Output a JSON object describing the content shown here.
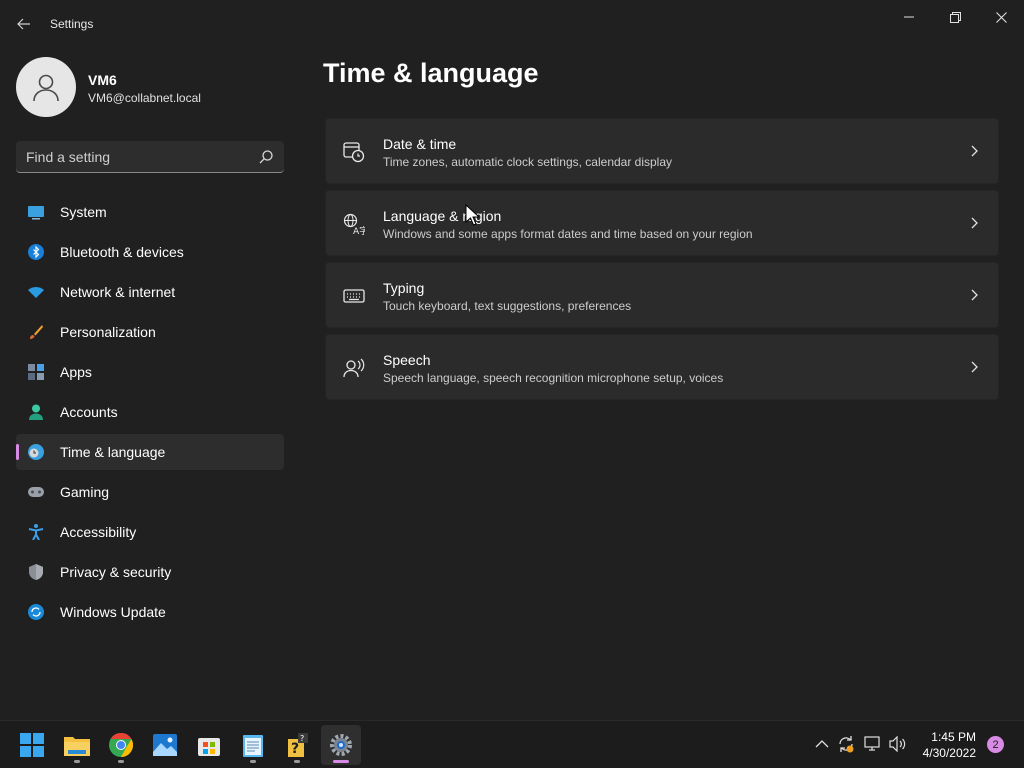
{
  "window": {
    "title": "Settings",
    "controls": {
      "minimize": "minimize-icon",
      "maximize": "restore-icon",
      "close": "close-icon"
    }
  },
  "profile": {
    "name": "VM6",
    "email": "VM6@collabnet.local"
  },
  "search": {
    "placeholder": "Find a setting"
  },
  "sidebar": {
    "items": [
      {
        "label": "System",
        "icon": "system-icon",
        "selected": false
      },
      {
        "label": "Bluetooth & devices",
        "icon": "bluetooth-icon",
        "selected": false
      },
      {
        "label": "Network & internet",
        "icon": "wifi-icon",
        "selected": false
      },
      {
        "label": "Personalization",
        "icon": "brush-icon",
        "selected": false
      },
      {
        "label": "Apps",
        "icon": "apps-icon",
        "selected": false
      },
      {
        "label": "Accounts",
        "icon": "accounts-icon",
        "selected": false
      },
      {
        "label": "Time & language",
        "icon": "time-language-icon",
        "selected": true
      },
      {
        "label": "Gaming",
        "icon": "gamepad-icon",
        "selected": false
      },
      {
        "label": "Accessibility",
        "icon": "accessibility-icon",
        "selected": false
      },
      {
        "label": "Privacy & security",
        "icon": "shield-icon",
        "selected": false
      },
      {
        "label": "Windows Update",
        "icon": "update-icon",
        "selected": false
      }
    ]
  },
  "main": {
    "title": "Time & language",
    "cards": [
      {
        "title": "Date & time",
        "description": "Time zones, automatic clock settings, calendar display",
        "icon": "calendar-clock-icon"
      },
      {
        "title": "Language & region",
        "description": "Windows and some apps format dates and time based on your region",
        "icon": "language-icon"
      },
      {
        "title": "Typing",
        "description": "Touch keyboard, text suggestions, preferences",
        "icon": "keyboard-icon"
      },
      {
        "title": "Speech",
        "description": "Speech language, speech recognition microphone setup, voices",
        "icon": "speech-icon"
      }
    ]
  },
  "taskbar": {
    "apps": [
      "start-icon",
      "file-explorer-icon",
      "chrome-icon",
      "photos-icon",
      "store-icon",
      "notepad-icon",
      "help-icon",
      "settings-icon"
    ],
    "active_app": "settings-icon",
    "tray": [
      "chevron-up-icon",
      "sync-icon",
      "network-icon",
      "volume-icon"
    ],
    "time": "1:45 PM",
    "date": "4/30/2022",
    "notifications": "2"
  },
  "colors": {
    "background": "#202020",
    "card": "#2b2b2b",
    "accent": "#d88be5"
  }
}
